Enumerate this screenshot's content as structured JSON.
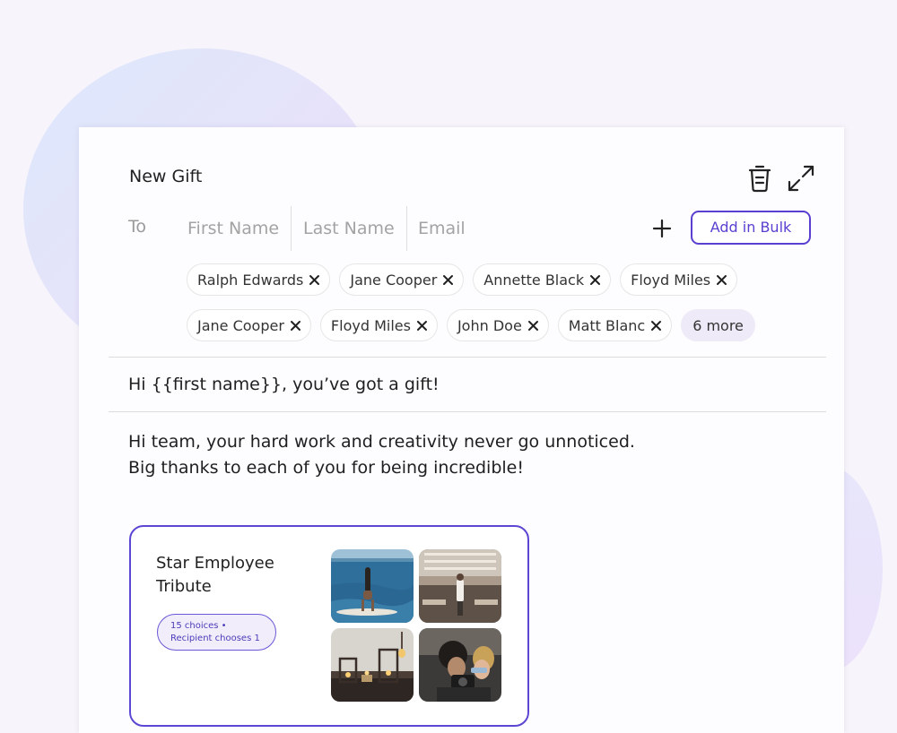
{
  "composer": {
    "title": "New Gift",
    "to_label": "To",
    "fields": {
      "first_name_placeholder": "First Name",
      "last_name_placeholder": "Last Name",
      "email_placeholder": "Email"
    },
    "add_in_bulk_label": "Add in Bulk",
    "recipients": [
      "Ralph Edwards",
      "Jane Cooper",
      "Annette Black",
      "Floyd Miles",
      "Jane Cooper",
      "Floyd Miles",
      "John Doe",
      "Matt Blanc"
    ],
    "more_label": "6 more",
    "subject": "Hi {{first name}}, you’ve got a gift!",
    "message_lines": [
      "Hi team, your hard work and creativity never go unnoticed.",
      "Big thanks to each of you for being incredible!"
    ]
  },
  "gift": {
    "title": "Star Employee Tribute",
    "badge_line1": "15 choices •",
    "badge_line2": "Recipient chooses 1",
    "images": [
      "handstand-paddleboard-photo",
      "restaurant-interior-photo",
      "candle-lanterns-photo",
      "photographer-camera-photo"
    ]
  },
  "icons": [
    "trash-icon",
    "expand-icon",
    "plus-icon",
    "close-icon"
  ],
  "colors": {
    "accent": "#5a3fd0",
    "background": "#f7f4fb",
    "more_chip": "#efeaf8"
  }
}
